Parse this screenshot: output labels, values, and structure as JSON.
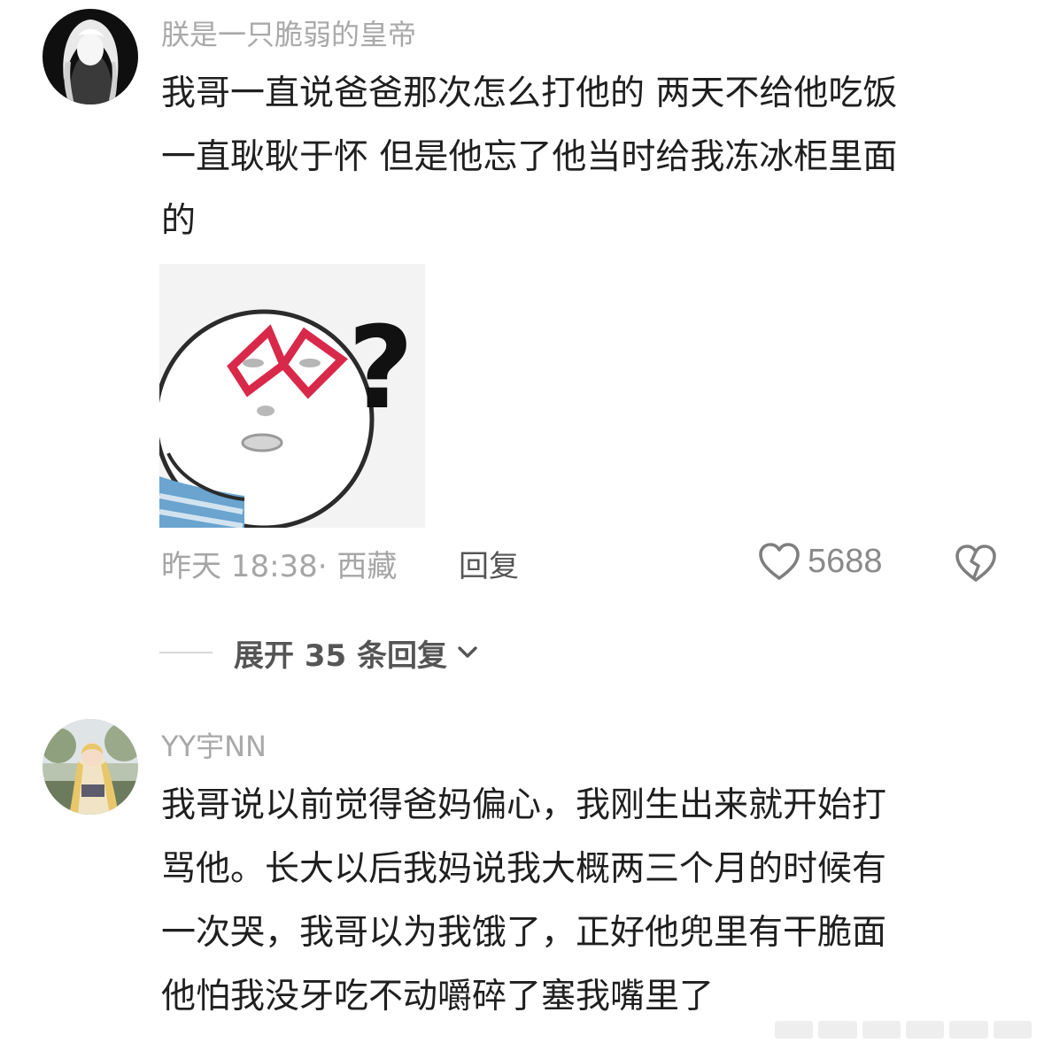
{
  "comments": [
    {
      "username": "朕是一只脆弱的皇帝",
      "text_lines": [
        "我哥一直说爸爸那次怎么打他的 两天不给他吃饭",
        "一直耿耿于怀 但是他忘了他当时给我冻冰柜里面",
        "的"
      ],
      "sticker_text": "?",
      "time_location": "昨天 18:38· 西藏",
      "reply_label": "回复",
      "like_count": "5688",
      "expand_label": "展开 35 条回复"
    },
    {
      "username": "YY宇NN",
      "text_lines": [
        "我哥说以前觉得爸妈偏心，我刚生出来就开始打",
        "骂他。长大以后我妈说我大概两三个月的时候有",
        "一次哭，我哥以为我饿了，正好他兜里有干脆面",
        "他怕我没牙吃不动嚼碎了塞我嘴里了"
      ]
    }
  ],
  "icons": {
    "like": "heart-outline-icon",
    "dislike": "broken-heart-icon",
    "expand": "chevron-down-icon"
  },
  "colors": {
    "username": "#a9a9a9",
    "body_text": "#1f1f1f",
    "meta": "#a6a6a6",
    "reply": "#555555",
    "sticker_glasses": "#d9294a"
  }
}
